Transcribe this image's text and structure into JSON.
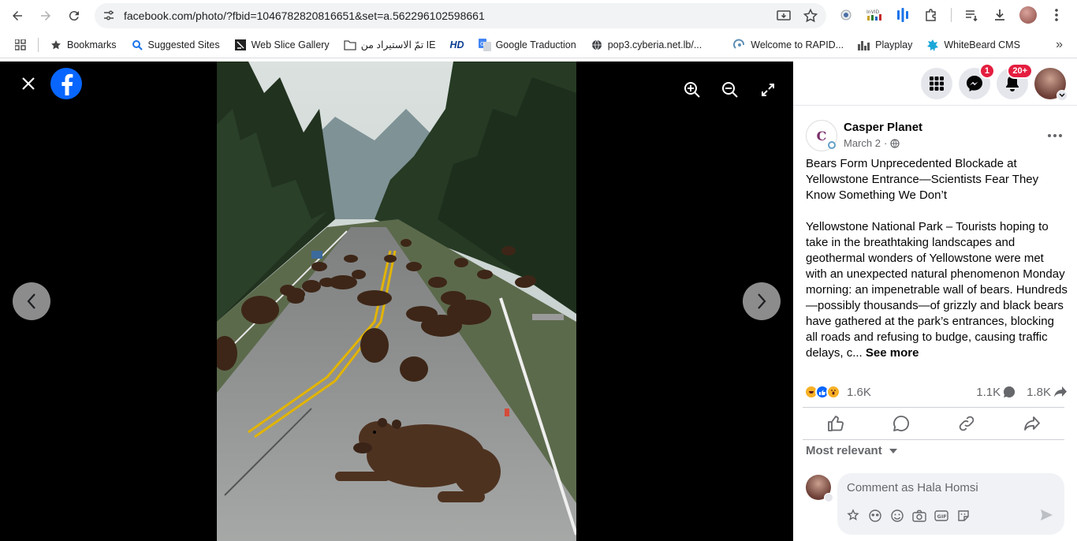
{
  "browser": {
    "url": "facebook.com/photo/?fbid=1046782820816651&set=a.562296102598661",
    "bookmarks": [
      {
        "label": "Bookmarks",
        "icon": "star-icon"
      },
      {
        "label": "Suggested Sites",
        "icon": "search-icon"
      },
      {
        "label": "Web Slice Gallery",
        "icon": "web-slice-icon"
      },
      {
        "label": "تمّ الاستيراد من IE",
        "icon": "folder-icon"
      },
      {
        "label": "HD",
        "icon": "hd-icon"
      },
      {
        "label": "Google Traduction",
        "icon": "translate-icon"
      },
      {
        "label": "pop3.cyberia.net.lb/...",
        "icon": "globe-icon"
      },
      {
        "label": "Welcome to RAPID...",
        "icon": "rapid-icon"
      },
      {
        "label": "Playplay",
        "icon": "playplay-icon"
      },
      {
        "label": "WhiteBeard CMS",
        "icon": "whitebeard-icon"
      }
    ]
  },
  "header": {
    "messenger_badge": "1",
    "notifications_badge": "20+"
  },
  "post": {
    "page_avatar_text": "C",
    "page_name": "Casper Planet",
    "date": "March 2",
    "separator": "·",
    "headline": "Bears Form Unprecedented Blockade at Yellowstone Entrance—Scientists Fear They Know Something We Don’t",
    "body": "Yellowstone National Park – Tourists hoping to take in the breathtaking landscapes and geothermal wonders of Yellowstone were met with an unexpected natural phenomenon Monday morning: an impenetrable wall of bears. Hundreds—possibly thousands—of grizzly and black bears have gathered at the park’s entrances, blocking all roads and refusing to budge, causing traffic delays, c...",
    "see_more": "See more",
    "reaction_count": "1.6K",
    "comment_count": "1.1K",
    "share_count": "1.8K",
    "sort_label": "Most relevant",
    "comment_placeholder": "Comment as Hala Homsi"
  }
}
